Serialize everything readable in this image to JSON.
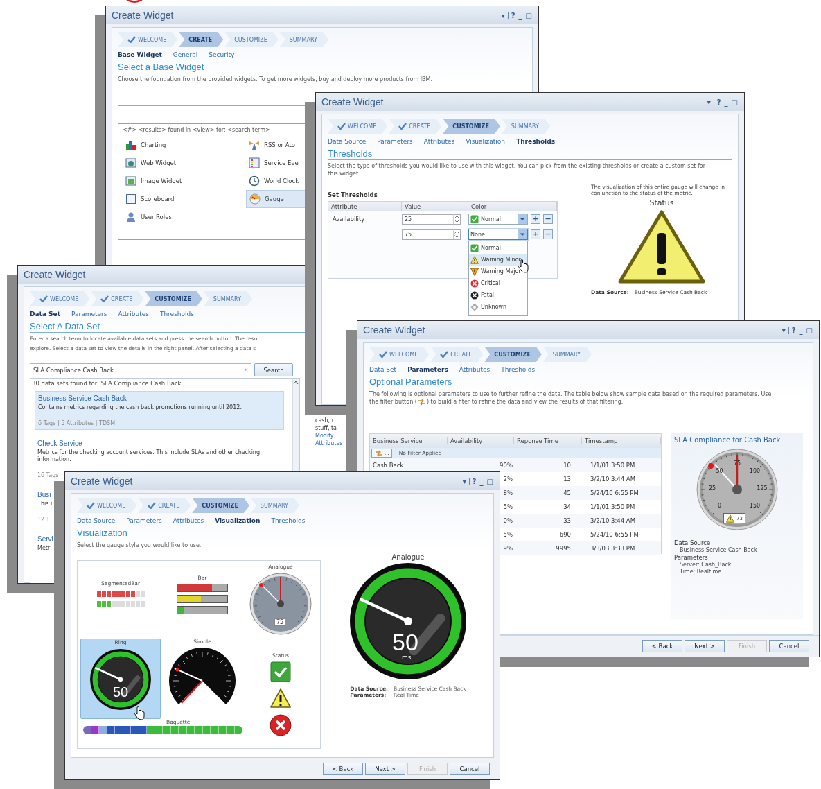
{
  "windows": [
    {
      "kind": "base_widget",
      "title": "Create Widget",
      "title_controls": [
        "▾",
        "?",
        "_",
        "□"
      ],
      "steps": [
        {
          "label": "WELCOME",
          "done": true,
          "selected": false
        },
        {
          "label": "CREATE",
          "done": false,
          "selected": true
        },
        {
          "label": "CUSTOMIZE",
          "done": false,
          "selected": false
        },
        {
          "label": "SUMMARY",
          "done": false,
          "selected": false
        }
      ],
      "subtabs": [
        {
          "label": "Base Widget",
          "selected": true
        },
        {
          "label": "General",
          "selected": false
        },
        {
          "label": "Security",
          "selected": false
        }
      ],
      "heading": "Select a Base Widget",
      "description": "Choose the foundation from the provided widgets.  To get more widgets, buy and deploy more products from IBM.",
      "results_label": "<#> <results> found in <view>  for: <search term>",
      "widgets": [
        {
          "label": "Charting",
          "kind": "chart",
          "selected": false
        },
        {
          "label": "Web Widget",
          "kind": "web",
          "selected": false
        },
        {
          "label": "Image Widget",
          "kind": "image",
          "selected": false
        },
        {
          "label": "Scoreboard",
          "kind": "board",
          "selected": false
        },
        {
          "label": "User Roles",
          "kind": "user",
          "selected": false
        },
        {
          "label": "RSS or Ato",
          "kind": "rss",
          "selected": false
        },
        {
          "label": "Service Eve",
          "kind": "grid",
          "selected": false
        },
        {
          "label": "World Clock",
          "kind": "clock",
          "selected": false
        },
        {
          "label": "Gauge",
          "kind": "gauge",
          "selected": true
        }
      ]
    },
    {
      "kind": "data_set",
      "title": "Create Widget",
      "steps": [
        {
          "label": "WELCOME",
          "done": true,
          "selected": false
        },
        {
          "label": "CREATE",
          "done": true,
          "selected": false
        },
        {
          "label": "CUSTOMIZE",
          "done": false,
          "selected": true
        },
        {
          "label": "SUMMARY",
          "done": false,
          "selected": false
        }
      ],
      "subtabs": [
        {
          "label": "Data Set",
          "selected": true
        },
        {
          "label": "Parameters",
          "selected": false
        },
        {
          "label": "Attributes",
          "selected": false
        },
        {
          "label": "Thresholds",
          "selected": false
        }
      ],
      "heading": "Select A Data Set",
      "description_lines": [
        "Enter a search term to locate available data sets and press the search button. The resul",
        "explore. Select a data set to view the details in the right panel.  After selecting a data s"
      ],
      "search": {
        "value": "SLA Compliance Cash Back",
        "clear": "×",
        "button": "Search"
      },
      "results_label": "30 data sets found for: SLA Compliance Cash Back",
      "results": [
        {
          "title": "Business Service Cash Back",
          "text": "Contains metrics regarding the cash back promotions running until 2012.",
          "meta": "6 Tags | 5 Attributes | TDSM",
          "selected": true
        },
        {
          "title": "Check Service",
          "text": "Metrics for the checking account services.  This include SLAs and other checking information.",
          "meta": "16 Tags",
          "selected": false
        },
        {
          "title": "Busi",
          "text": "This i",
          "meta": "12 T",
          "selected": false
        },
        {
          "title": "Servi",
          "text": "Metri",
          "selected": false
        }
      ],
      "side_items": [
        {
          "text": "cash, r",
          "kind": "text"
        },
        {
          "text": "stuff, ta",
          "kind": "text"
        },
        {
          "text": "Modify",
          "kind": "link"
        },
        {
          "text": "Attributes",
          "kind": "link"
        }
      ]
    },
    {
      "kind": "thresholds",
      "title": "Create Widget",
      "title_controls": [
        "▾",
        "?",
        "_",
        "□"
      ],
      "steps": [
        {
          "label": "WELCOME",
          "done": true,
          "selected": false
        },
        {
          "label": "CREATE",
          "done": true,
          "selected": false
        },
        {
          "label": "CUSTOMIZE",
          "done": false,
          "selected": true
        },
        {
          "label": "SUMMARY",
          "done": false,
          "selected": false
        }
      ],
      "subtabs": [
        {
          "label": "Data Source",
          "selected": false
        },
        {
          "label": "Parameters",
          "selected": false
        },
        {
          "label": "Attributes",
          "selected": false
        },
        {
          "label": "Visualization",
          "selected": false
        },
        {
          "label": "Thresholds",
          "selected": true
        }
      ],
      "heading": "Thresholds",
      "description": "Select the type of thresholds you would like to use with this widget.  You can pick from the existing thresholds or create a custom set for this widget.",
      "section_title": "Set Thresholds",
      "columns": [
        "Attribute",
        "Value",
        "Color"
      ],
      "rows": [
        {
          "attribute": "Availability",
          "value": "25",
          "color": {
            "label": "Normal",
            "kind": "normal"
          },
          "open": false,
          "buttons": [
            "+",
            "−"
          ]
        },
        {
          "value": "75",
          "color": {
            "label": "None",
            "kind": "none"
          },
          "open": true,
          "buttons": [
            "+",
            "−"
          ]
        }
      ],
      "options": [
        {
          "label": "Normal",
          "kind": "normal",
          "highlighted": false
        },
        {
          "label": "Warning Minor",
          "kind": "warning_minor",
          "highlighted": true
        },
        {
          "label": "Warning Major",
          "kind": "warning_major",
          "highlighted": false
        },
        {
          "label": "Critical",
          "kind": "critical",
          "highlighted": false
        },
        {
          "label": "Fatal",
          "kind": "fatal",
          "highlighted": false
        },
        {
          "label": "Unknown",
          "kind": "unknown",
          "highlighted": false
        }
      ],
      "status_panel": {
        "note": "The visualization of this entire gauge will change in conjunction to the status of the metric.",
        "title": "Status",
        "details": [
          {
            "label": "Data Source:",
            "value": "Business Service Cash Back"
          }
        ]
      }
    },
    {
      "kind": "parameters",
      "title": "Create Widget",
      "title_controls": [
        "▾",
        "?",
        "_",
        "□"
      ],
      "steps": [
        {
          "label": "WELCOME",
          "done": true,
          "selected": false
        },
        {
          "label": "CREATE",
          "done": true,
          "selected": false
        },
        {
          "label": "CUSTOMIZE",
          "done": false,
          "selected": true
        },
        {
          "label": "SUMMARY",
          "done": false,
          "selected": false
        }
      ],
      "subtabs": [
        {
          "label": "Data Set",
          "selected": false
        },
        {
          "label": "Parameters",
          "selected": true
        },
        {
          "label": "Attributes",
          "selected": false
        },
        {
          "label": "Thresholds",
          "selected": false
        }
      ],
      "heading": "Optional Parameters",
      "description_parts": [
        "The following is optional parameters to use to further refine the data.  The table below show sample data based on the required parameters. Use the filter button (",
        ") to build a fiter to refine the data and view the results of that filtering."
      ],
      "columns": [
        "Business Service",
        "Availability",
        "Reponse Time",
        "Timestamp"
      ],
      "filter": {
        "button": "...",
        "label": "No Filter Applied"
      },
      "rows": [
        {
          "service": "Cash Back",
          "availability": "90%",
          "response": "10",
          "timestamp": "1/1/01 3:50 PM"
        },
        {
          "availability": "2%",
          "response": "13",
          "timestamp": "3/2/10 3:44 AM"
        },
        {
          "availability": "8%",
          "response": "45",
          "timestamp": "5/24/10 6:55 PM"
        },
        {
          "availability": "5%",
          "response": "34",
          "timestamp": "1/1/01 3:50 PM"
        },
        {
          "availability": "0%",
          "response": "33",
          "timestamp": "3/2/10 3:44 AM"
        },
        {
          "availability": "5%",
          "response": "690",
          "timestamp": "5/24/10 6:55 PM"
        },
        {
          "availability": "9%",
          "response": "9995",
          "timestamp": "3/3/03 3:33 PM"
        }
      ],
      "sla": {
        "title": "SLA Compliance for Cash Back",
        "labels": [
          "0",
          "25",
          "50",
          "75",
          "100",
          "125",
          "150"
        ],
        "badge": "73",
        "details": [
          {
            "text": "Data Source",
            "kind": "heading"
          },
          {
            "text": "Business Service Cash Back",
            "kind": "item"
          },
          {
            "text": "Parameters",
            "kind": "heading"
          },
          {
            "text": "Server: Cash_Back",
            "kind": "item"
          },
          {
            "text": "Time: Realtime",
            "kind": "item"
          }
        ]
      },
      "buttons": [
        {
          "label": "< Back",
          "disabled": false
        },
        {
          "label": "Next >",
          "disabled": false
        },
        {
          "label": "Finish",
          "disabled": true
        },
        {
          "label": "Cancel",
          "disabled": false
        }
      ]
    },
    {
      "kind": "visualization",
      "title": "Create Widget",
      "title_controls": [
        "▾",
        "?",
        "_",
        "□"
      ],
      "steps": [
        {
          "label": "WELCOME",
          "done": true,
          "selected": false
        },
        {
          "label": "CREATE",
          "done": true,
          "selected": false
        },
        {
          "label": "CUSTOMIZE",
          "done": false,
          "selected": true
        },
        {
          "label": "SUMMARY",
          "done": false,
          "selected": false
        }
      ],
      "subtabs": [
        {
          "label": "Data Source",
          "selected": false
        },
        {
          "label": "Parameters",
          "selected": false
        },
        {
          "label": "Attributes",
          "selected": false
        },
        {
          "label": "Visualization",
          "selected": true
        },
        {
          "label": "Thresholds",
          "selected": false
        }
      ],
      "heading": "Visualization",
      "description": "Select the gauge style you would like to use.",
      "gallery": [
        {
          "kind": "segmented",
          "label": "SegmentedBar",
          "selected": false,
          "bars": [
            {
              "level": 0.8,
              "color": "#e04848"
            },
            {
              "level": 0.3,
              "color": "#4cc13c"
            }
          ]
        },
        {
          "kind": "bar",
          "label": "Bar",
          "selected": false,
          "bars": [
            {
              "level": 0.7,
              "color": "#d23a3a"
            },
            {
              "level": 0.47,
              "color": "#e2d62c"
            },
            {
              "level": 0.12,
              "color": "#3cb83a"
            }
          ]
        },
        {
          "kind": "analogue",
          "label": "Analogue",
          "selected": false,
          "badge": "75"
        },
        {
          "kind": "ring",
          "label": "Ring",
          "selected": true,
          "value": "50"
        },
        {
          "kind": "simple",
          "label": "Simple",
          "selected": false
        },
        {
          "kind": "status",
          "label": "Status",
          "selected": false
        },
        {
          "kind": "baguette",
          "label": "Baguette",
          "selected": false
        }
      ],
      "preview": {
        "title": "Analogue",
        "value": "50",
        "unit": "ms",
        "details": [
          {
            "label": "Data Source:",
            "value": "Business Service Cash Back"
          },
          {
            "label": "Parameters:",
            "value": "Real Time"
          }
        ]
      },
      "buttons": [
        {
          "label": "< Back",
          "disabled": false
        },
        {
          "label": "Next >",
          "disabled": false
        },
        {
          "label": "Finish",
          "disabled": true
        },
        {
          "label": "Cancel",
          "disabled": false
        }
      ]
    }
  ]
}
